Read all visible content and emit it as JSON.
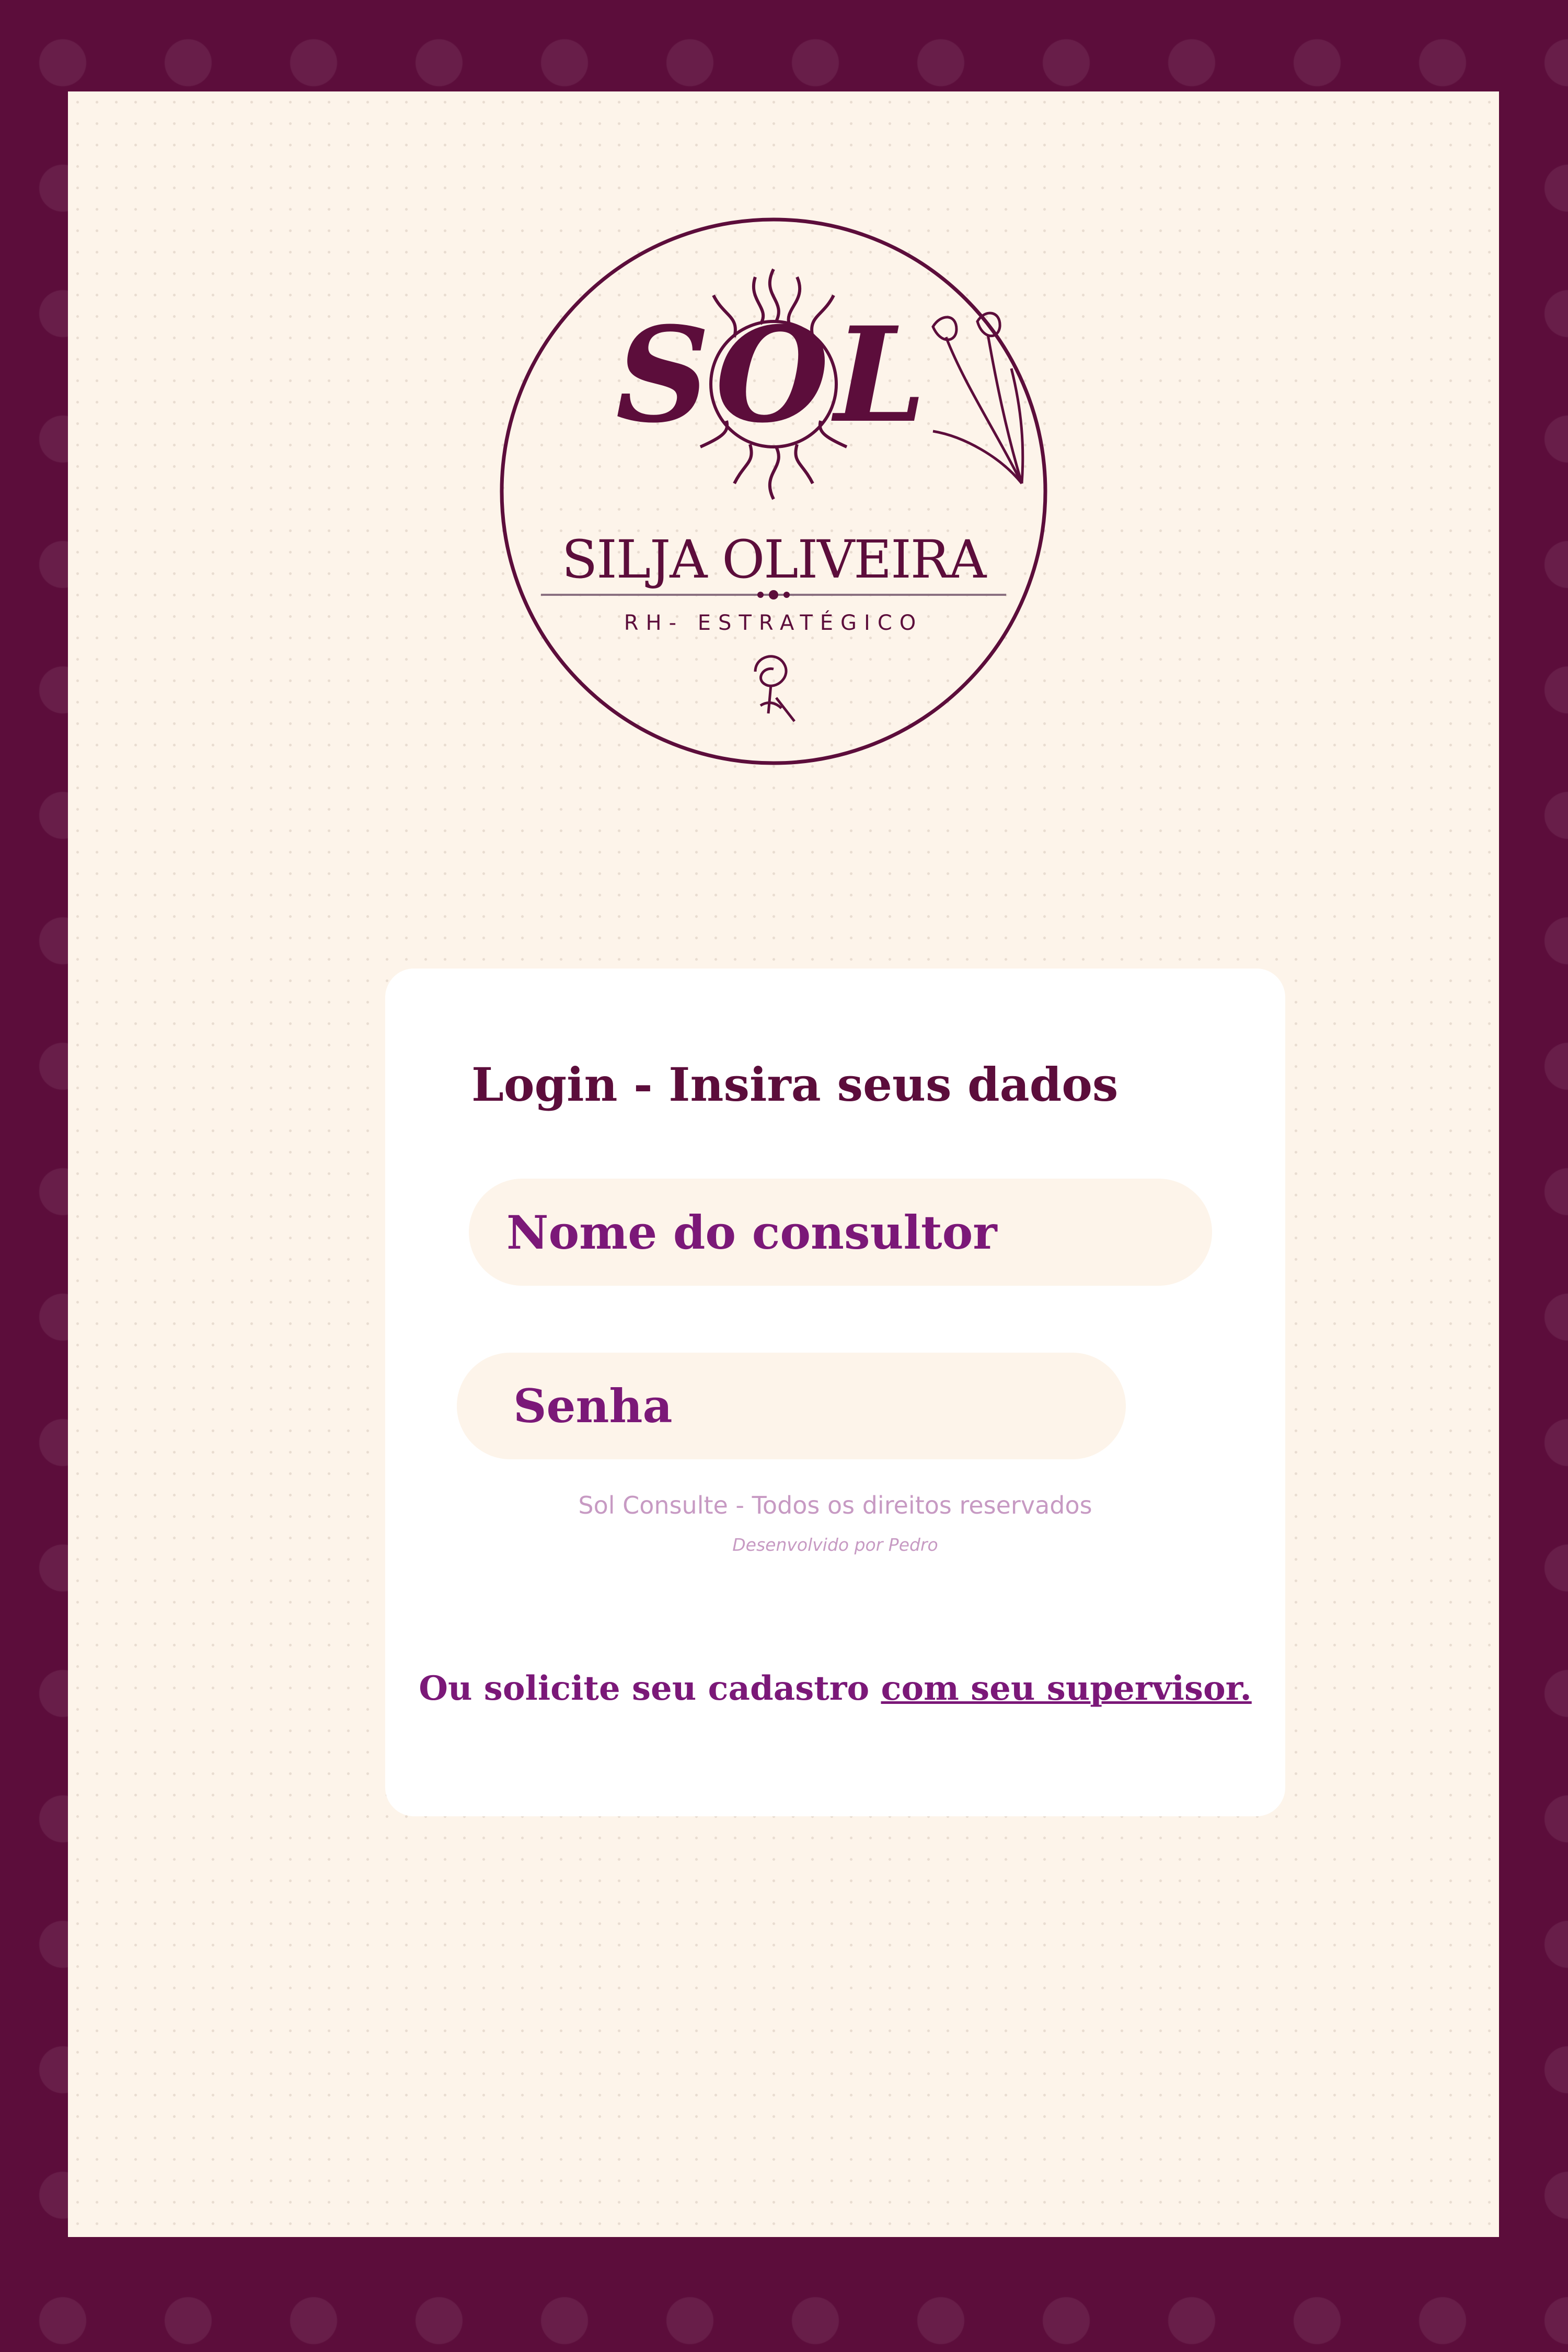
{
  "logo": {
    "monogram": "SOL",
    "name": "SILJA OLIVEIRA",
    "tagline": "RH-  ESTRATÉGICO",
    "icon": "sun-and-flowers-logo"
  },
  "login": {
    "heading": "Login - Insira seus dados",
    "username_placeholder": "Nome do consultor",
    "password_placeholder": "Senha"
  },
  "footer": {
    "copyright": "Sol Consulte - Todos os direitos reservados",
    "developer": "Desenvolvido por Pedro"
  },
  "signup": {
    "prefix": "Ou solicite seu cadastro ",
    "link_label": "com seu supervisor."
  },
  "colors": {
    "frame": "#5c0d3b",
    "page": "#fdf4ea",
    "card": "#ffffff",
    "accent": "#7b1878",
    "muted": "#c79ac3"
  }
}
